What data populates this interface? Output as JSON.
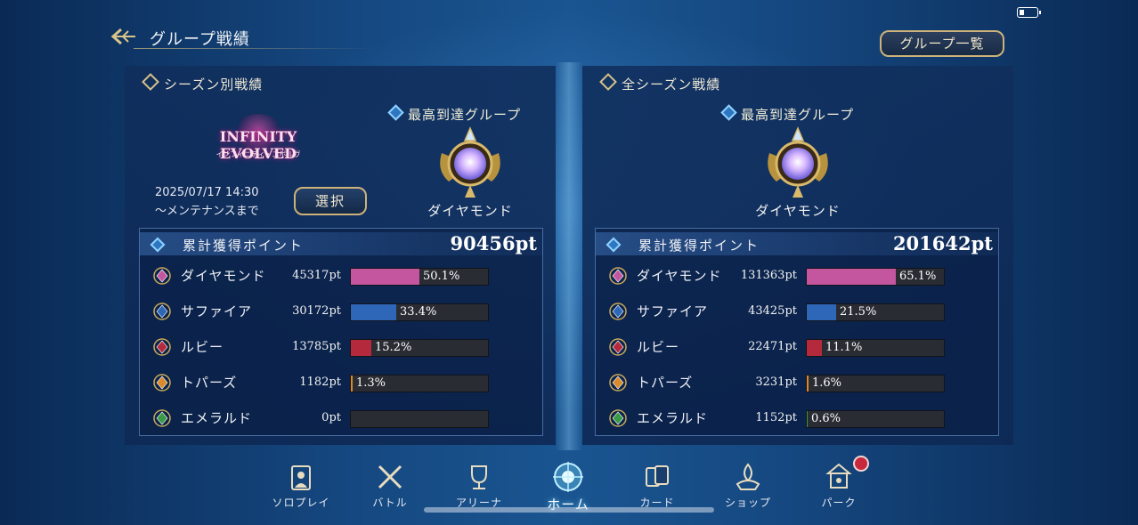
{
  "header": {
    "title": "グループ戦績",
    "group_list_button": "グループ一覧"
  },
  "season_panel": {
    "section_title": "シーズン別戦績",
    "logo_text": "INFINITY EVOLVED",
    "logo_subtext": "インフィニティ・エボルヴ",
    "deadline_date": "2025/07/17 14:30",
    "deadline_suffix": "〜メンテナンスまで",
    "select_button": "選択",
    "best_group_label": "最高到達グループ",
    "best_group_name": "ダイヤモンド",
    "points_label": "累計獲得ポイント",
    "points_total": "90456pt",
    "rows": [
      {
        "name": "ダイヤモンド",
        "pts": "45317pt",
        "pct": "50.1%",
        "value": 50.1,
        "color": "#c4569f"
      },
      {
        "name": "サファイア",
        "pts": "30172pt",
        "pct": "33.4%",
        "value": 33.4,
        "color": "#2e66b8"
      },
      {
        "name": "ルビー",
        "pts": "13785pt",
        "pct": "15.2%",
        "value": 15.2,
        "color": "#b42a3c"
      },
      {
        "name": "トパーズ",
        "pts": "1182pt",
        "pct": "1.3%",
        "value": 1.3,
        "color": "#d88a2c"
      },
      {
        "name": "エメラルド",
        "pts": "0pt",
        "pct": "",
        "value": 0,
        "color": "#3a9a48"
      }
    ]
  },
  "all_panel": {
    "section_title": "全シーズン戦績",
    "best_group_label": "最高到達グループ",
    "best_group_name": "ダイヤモンド",
    "points_label": "累計獲得ポイント",
    "points_total": "201642pt",
    "rows": [
      {
        "name": "ダイヤモンド",
        "pts": "131363pt",
        "pct": "65.1%",
        "value": 65.1,
        "color": "#c4569f"
      },
      {
        "name": "サファイア",
        "pts": "43425pt",
        "pct": "21.5%",
        "value": 21.5,
        "color": "#2e66b8"
      },
      {
        "name": "ルビー",
        "pts": "22471pt",
        "pct": "11.1%",
        "value": 11.1,
        "color": "#b42a3c"
      },
      {
        "name": "トパーズ",
        "pts": "3231pt",
        "pct": "1.6%",
        "value": 1.6,
        "color": "#d88a2c"
      },
      {
        "name": "エメラルド",
        "pts": "1152pt",
        "pct": "0.6%",
        "value": 0.6,
        "color": "#3a9a48"
      }
    ]
  },
  "nav": [
    {
      "label": "ソロプレイ",
      "icon": "solo-play-icon"
    },
    {
      "label": "バトル",
      "icon": "battle-swords-icon"
    },
    {
      "label": "アリーナ",
      "icon": "arena-trophy-icon"
    },
    {
      "label": "ホーム",
      "icon": "home-icon",
      "active": true
    },
    {
      "label": "カード",
      "icon": "cards-icon"
    },
    {
      "label": "ショップ",
      "icon": "shop-icon"
    },
    {
      "label": "パーク",
      "icon": "park-icon",
      "badge": true
    }
  ]
}
